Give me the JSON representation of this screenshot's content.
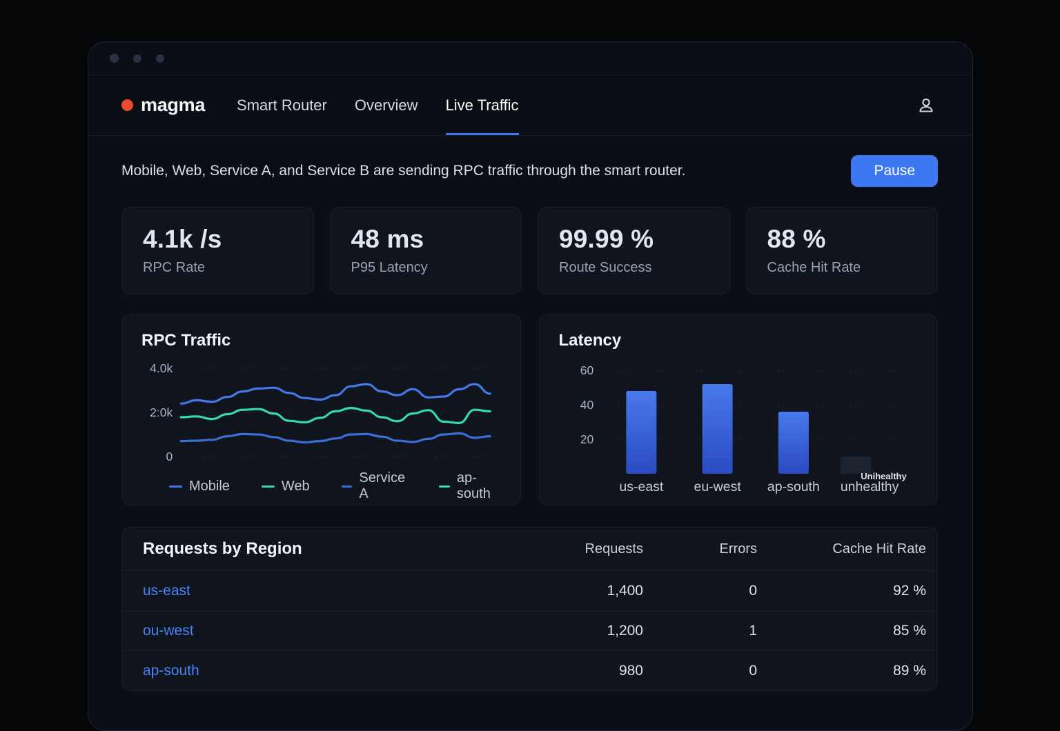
{
  "theme": {
    "colors": {
      "bg": "#050608",
      "window": "#0a0e15",
      "card": "#0f141d",
      "text": "#e8ecf2",
      "muted": "#98a2b3",
      "accent": "#3b78f2",
      "link": "#4b84f7",
      "logo-dot": "#e94b2c"
    }
  },
  "header": {
    "logo": "magma",
    "nav": [
      {
        "label": "Smart Router",
        "active": false
      },
      {
        "label": "Overview",
        "active": false
      },
      {
        "label": "Live Traffic",
        "active": true
      }
    ]
  },
  "status": {
    "message": "Mobile, Web, Service A, and Service B are sending RPC traffic through the smart router.",
    "pause_label": "Pause"
  },
  "stats": [
    {
      "value": "4.1k /s",
      "label": "RPC Rate"
    },
    {
      "value": "48 ms",
      "label": "P95 Latency"
    },
    {
      "value": "99.99 %",
      "label": "Route Success"
    },
    {
      "value": "88 %",
      "label": "Cache Hit Rate"
    }
  ],
  "chart_data": [
    {
      "type": "line",
      "title": "RPC Traffic",
      "unit": "k requests/s",
      "ylim": [
        0,
        4.0
      ],
      "grid": true,
      "legend_position": "bottom",
      "yticks": [
        {
          "label": "4.0k",
          "value": 4.0
        },
        {
          "label": "2:0k",
          "value": 2.0
        },
        {
          "label": "0",
          "value": 0
        }
      ],
      "legend": [
        {
          "label": "Mobile",
          "color": "#4478e8"
        },
        {
          "label": "Web",
          "color": "#35d9ab"
        },
        {
          "label": "Service A",
          "color": "#3a6fd8"
        },
        {
          "label": "ap-south",
          "color": "#32d6c3"
        }
      ],
      "series": [
        {
          "name": "Mobile",
          "color": "#4478e8",
          "values": [
            2.4,
            2.55,
            2.48,
            2.7,
            2.95,
            3.08,
            3.12,
            2.88,
            2.65,
            2.58,
            2.78,
            3.18,
            3.28,
            2.95,
            2.78,
            3.05,
            2.68,
            2.72,
            3.05,
            3.28,
            2.85
          ]
        },
        {
          "name": "Web",
          "color": "#35d9ab",
          "values": [
            1.78,
            1.82,
            1.7,
            1.92,
            2.12,
            2.15,
            1.95,
            1.62,
            1.55,
            1.75,
            2.05,
            2.2,
            2.08,
            1.78,
            1.6,
            1.95,
            2.1,
            1.58,
            1.52,
            2.12,
            2.05
          ]
        },
        {
          "name": "Service A",
          "color": "#3a6fd8",
          "values": [
            0.7,
            0.72,
            0.76,
            0.92,
            1.02,
            1.0,
            0.88,
            0.72,
            0.64,
            0.7,
            0.82,
            1.0,
            1.02,
            0.9,
            0.72,
            0.66,
            0.8,
            1.0,
            1.05,
            0.85,
            0.92
          ]
        }
      ]
    },
    {
      "type": "bar",
      "title": "Latency",
      "categories": [
        "us-east",
        "eu-west",
        "ap-south",
        "unhealthy"
      ],
      "values": [
        48,
        52,
        36,
        10
      ],
      "muted_index": 3,
      "annotation": "Unihealthy",
      "yticks": [
        20,
        40,
        60
      ],
      "ylim": [
        0,
        66
      ],
      "grid": true,
      "bar_gradient_top": "#4879ec",
      "bar_gradient_bottom": "#2a4bc0",
      "muted_bar_color": "#1d2430"
    }
  ],
  "table": {
    "title": "Requests by Region",
    "columns": [
      "Requests",
      "Errors",
      "Cache Hit Rate"
    ],
    "rows": [
      {
        "region": "us-east",
        "requests": "1,400",
        "errors": "0",
        "cache_hit_rate": "92 %"
      },
      {
        "region": "ou-west",
        "requests": "1,200",
        "errors": "1",
        "cache_hit_rate": "85 %"
      },
      {
        "region": "ap-south",
        "requests": "980",
        "errors": "0",
        "cache_hit_rate": "89 %"
      }
    ]
  }
}
